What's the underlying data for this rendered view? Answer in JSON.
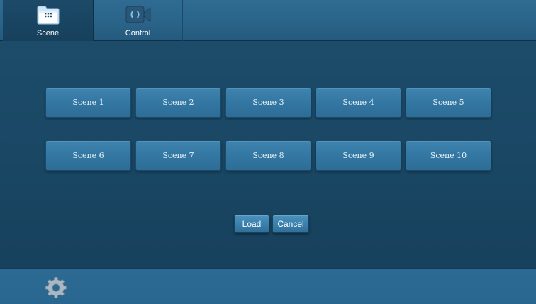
{
  "tabs": [
    {
      "label": "Scene",
      "icon": "grid-folder-icon",
      "active": true
    },
    {
      "label": "Control",
      "icon": "video-control-icon",
      "active": false
    }
  ],
  "scenes": [
    {
      "label": "Scene 1"
    },
    {
      "label": "Scene 2"
    },
    {
      "label": "Scene 3"
    },
    {
      "label": "Scene 4"
    },
    {
      "label": "Scene 5"
    },
    {
      "label": "Scene 6"
    },
    {
      "label": "Scene 7"
    },
    {
      "label": "Scene 8"
    },
    {
      "label": "Scene 9"
    },
    {
      "label": "Scene 10"
    }
  ],
  "actions": {
    "load_label": "Load",
    "cancel_label": "Cancel"
  },
  "bottom": {
    "settings_icon": "gear-icon"
  },
  "colors": {
    "background": "#1a4865",
    "bar": "#2a6388",
    "button": "#3478a3",
    "text": "#ffffff"
  }
}
